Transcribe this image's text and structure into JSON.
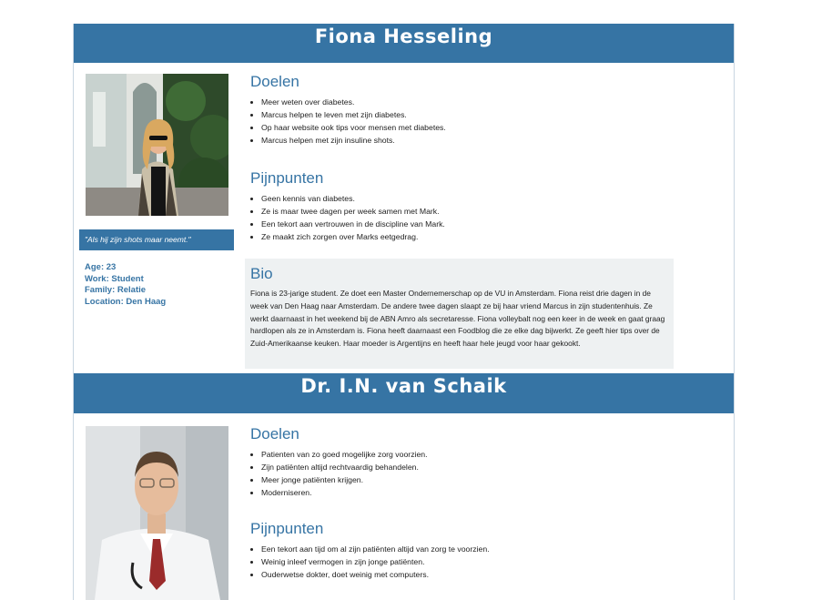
{
  "personas": [
    {
      "name": "Fiona Hesseling",
      "quote": "\"Als hij zijn shots maar neemt.\"",
      "facts": {
        "age": "Age: 23",
        "work": "Work: Student",
        "family": "Family: Relatie",
        "location": "Location: Den Haag"
      },
      "goals_title": "Doelen",
      "goals": [
        "Meer weten over diabetes.",
        "Marcus helpen te leven met zijn diabetes.",
        "Op haar website ook tips voor mensen met diabetes.",
        "Marcus helpen met zijn insuline shots."
      ],
      "pains_title": "Pijnpunten",
      "pains": [
        "Geen kennis van diabetes.",
        "Ze is maar twee dagen per week samen met Mark.",
        "Een tekort aan vertrouwen in de discipline van Mark.",
        "Ze maakt zich zorgen over Marks eetgedrag."
      ],
      "bio_title": "Bio",
      "bio": "Fiona is 23-jarige student. Ze doet een Master Ondernemerschap op de VU in Amsterdam. Fiona reist drie dagen in de week van Den Haag naar Amsterdam. De andere twee dagen slaapt ze bij haar vriend Marcus in zijn studentenhuis. Ze werkt daarnaast in het weekend bij de ABN Amro als secretaresse. Fiona volleybalt nog een keer in de week en gaat graag hardlopen als ze in Amsterdam is. Fiona heeft daarnaast een Foodblog die ze elke dag bijwerkt. Ze geeft hier tips over de Zuid-Amerikaanse keuken. Haar moeder is Argentijns en heeft haar hele jeugd voor haar gekookt."
    },
    {
      "name": "Dr. I.N. van Schaik",
      "goals_title": "Doelen",
      "goals": [
        "Patienten van zo goed mogelijke zorg voorzien.",
        "Zijn patiënten altijd rechtvaardig behandelen.",
        "Meer jonge patiënten krijgen.",
        "Moderniseren."
      ],
      "pains_title": "Pijnpunten",
      "pains": [
        "Een tekort aan tijd om al zijn patiënten altijd van zorg te voorzien.",
        "Weinig inleef vermogen in zijn jonge patiënten.",
        "Ouderwetse dokter, doet weinig met computers."
      ]
    }
  ]
}
